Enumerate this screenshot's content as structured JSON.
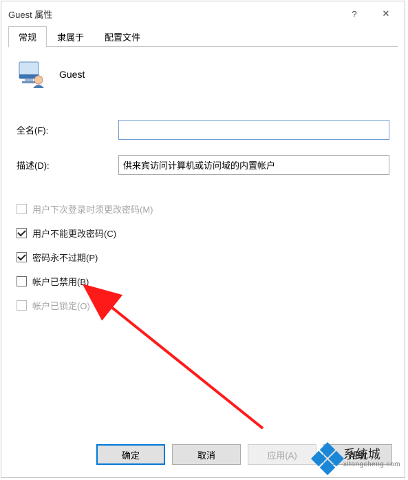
{
  "window": {
    "title": "Guest 属性",
    "help_icon": "?",
    "close_icon": "✕"
  },
  "tabs": [
    {
      "label": "常规",
      "active": true
    },
    {
      "label": "隶属于",
      "active": false
    },
    {
      "label": "配置文件",
      "active": false
    }
  ],
  "user": {
    "display_name": "Guest"
  },
  "fields": {
    "fullname_label": "全名(F):",
    "fullname_value": "",
    "description_label": "描述(D):",
    "description_value": "供来宾访问计算机或访问域的内置帐户"
  },
  "checkboxes": [
    {
      "key": "must_change",
      "label": "用户下次登录时须更改密码(M)",
      "checked": false,
      "disabled": true
    },
    {
      "key": "cannot_change",
      "label": "用户不能更改密码(C)",
      "checked": true,
      "disabled": false
    },
    {
      "key": "never_expire",
      "label": "密码永不过期(P)",
      "checked": true,
      "disabled": false
    },
    {
      "key": "disabled_acc",
      "label": "帐户已禁用(B)",
      "checked": false,
      "disabled": false
    },
    {
      "key": "locked",
      "label": "帐户已锁定(O)",
      "checked": false,
      "disabled": true
    }
  ],
  "buttons": {
    "ok": "确定",
    "cancel": "取消",
    "apply": "应用(A)",
    "help": "帮助"
  },
  "watermark": {
    "brand": "系统城",
    "url": "xitongcheng.com"
  }
}
